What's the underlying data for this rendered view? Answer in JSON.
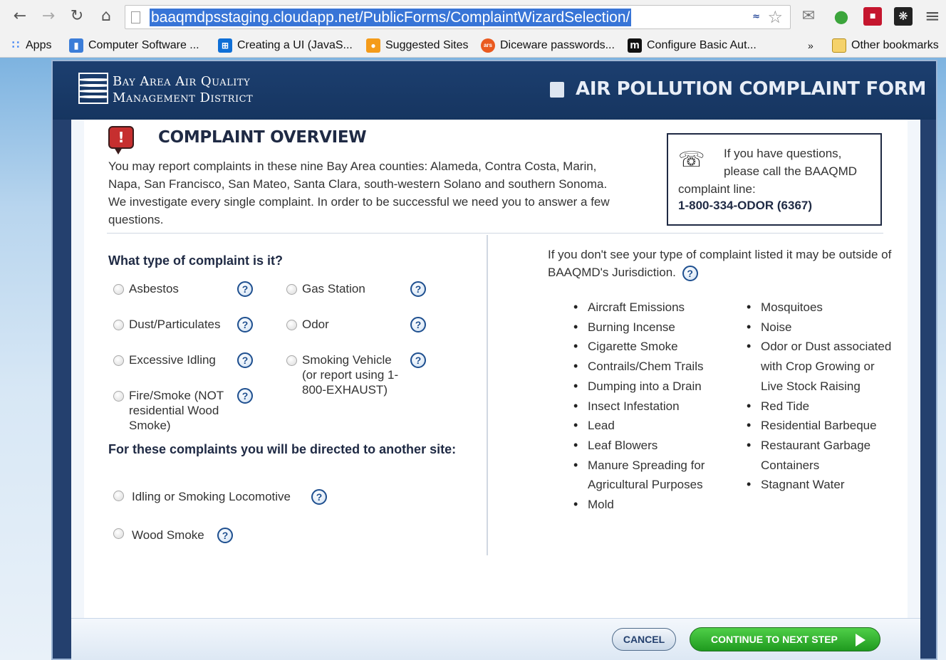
{
  "browser": {
    "url": "baaqmdpsstaging.cloudapp.net/PublicForms/ComplaintWizardSelection/",
    "bookmarks": [
      {
        "label": "Apps",
        "icon": "apps-grid-icon"
      },
      {
        "label": "Computer Software ...",
        "icon": "chart-icon"
      },
      {
        "label": "Creating a UI (JavaS...",
        "icon": "windows-icon"
      },
      {
        "label": "Suggested Sites",
        "icon": "bulb-icon"
      },
      {
        "label": "Diceware passwords...",
        "icon": "ars-icon"
      },
      {
        "label": "Configure Basic Aut...",
        "icon": "m-icon"
      },
      {
        "label": "»",
        "icon": "overflow-icon"
      },
      {
        "label": "Other bookmarks",
        "icon": "folder-icon"
      }
    ]
  },
  "header": {
    "logo_line1": "Bay Area Air Quality",
    "logo_line2": "Management District",
    "form_title": "AIR POLLUTION COMPLAINT FORM"
  },
  "overview": {
    "title": "COMPLAINT OVERVIEW",
    "text": "You may report complaints in these nine Bay Area counties: Alameda, Contra Costa, Marin, Napa, San Francisco, San Mateo, Santa Clara, south-western Solano and southern Sonoma. We investigate every single complaint. In order to be successful we need you to answer a few questions."
  },
  "contact": {
    "text1": "If you have questions, please call the BAAQMD",
    "text2": "complaint line:",
    "phone": "1-800-334-ODOR (6367)"
  },
  "complaint_types": {
    "question": "What type of complaint is it?",
    "options": [
      {
        "label": "Asbestos"
      },
      {
        "label": "Gas Station"
      },
      {
        "label": "Dust/Particulates"
      },
      {
        "label": "Odor"
      },
      {
        "label": "Excessive Idling"
      },
      {
        "label": "Smoking Vehicle (or report using 1-800-EXHAUST)"
      },
      {
        "label": "Fire/Smoke (NOT residential Wood Smoke)"
      }
    ]
  },
  "redirect": {
    "title": "For these complaints you will be directed to another site:",
    "options": [
      {
        "label": "Idling or Smoking Locomotive"
      },
      {
        "label": "Wood Smoke"
      }
    ]
  },
  "outside": {
    "text": "If you don't see your type of complaint listed it may be outside of BAAQMD's Jurisdiction.",
    "list_left": [
      "Aircraft Emissions",
      "Burning Incense",
      "Cigarette Smoke",
      "Contrails/Chem Trails",
      "Dumping into a Drain",
      "Insect Infestation",
      "Lead",
      "Leaf Blowers",
      "Manure Spreading for Agricultural Purposes",
      "Mold"
    ],
    "list_right": [
      "Mosquitoes",
      "Noise",
      "Odor or Dust associated with Crop Growing or Live Stock Raising",
      "Red Tide",
      "Residential Barbeque",
      "Restaurant Garbage Containers",
      "Stagnant Water"
    ]
  },
  "buttons": {
    "cancel": "CANCEL",
    "continue": "CONTINUE TO NEXT STEP"
  },
  "help_glyph": "?"
}
